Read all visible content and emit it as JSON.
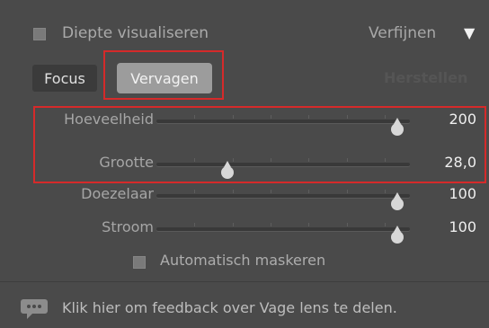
{
  "header": {
    "depth_label": "Diepte visualiseren",
    "refine_label": "Verfijnen",
    "refine_arrow": "▼"
  },
  "tabs": {
    "focus": "Focus",
    "blur": "Vervagen",
    "reset": "Herstellen"
  },
  "sliders": [
    {
      "label": "Hoeveelheid",
      "value": "200",
      "level": 0.95
    },
    {
      "label": "Grootte",
      "value": "28,0",
      "level": 0.28
    },
    {
      "label": "Doezelaar",
      "value": "100",
      "level": 0.95
    },
    {
      "label": "Stroom",
      "value": "100",
      "level": 0.95
    }
  ],
  "auto_mask": {
    "label": "Automatisch maskeren",
    "checked": false
  },
  "feedback": {
    "text": "Klik hier om feedback over Vage lens te delen.",
    "icon": "speech-bubble-icon"
  },
  "colors": {
    "highlight": "#d52a2a",
    "panel": "#4a4a4a"
  }
}
